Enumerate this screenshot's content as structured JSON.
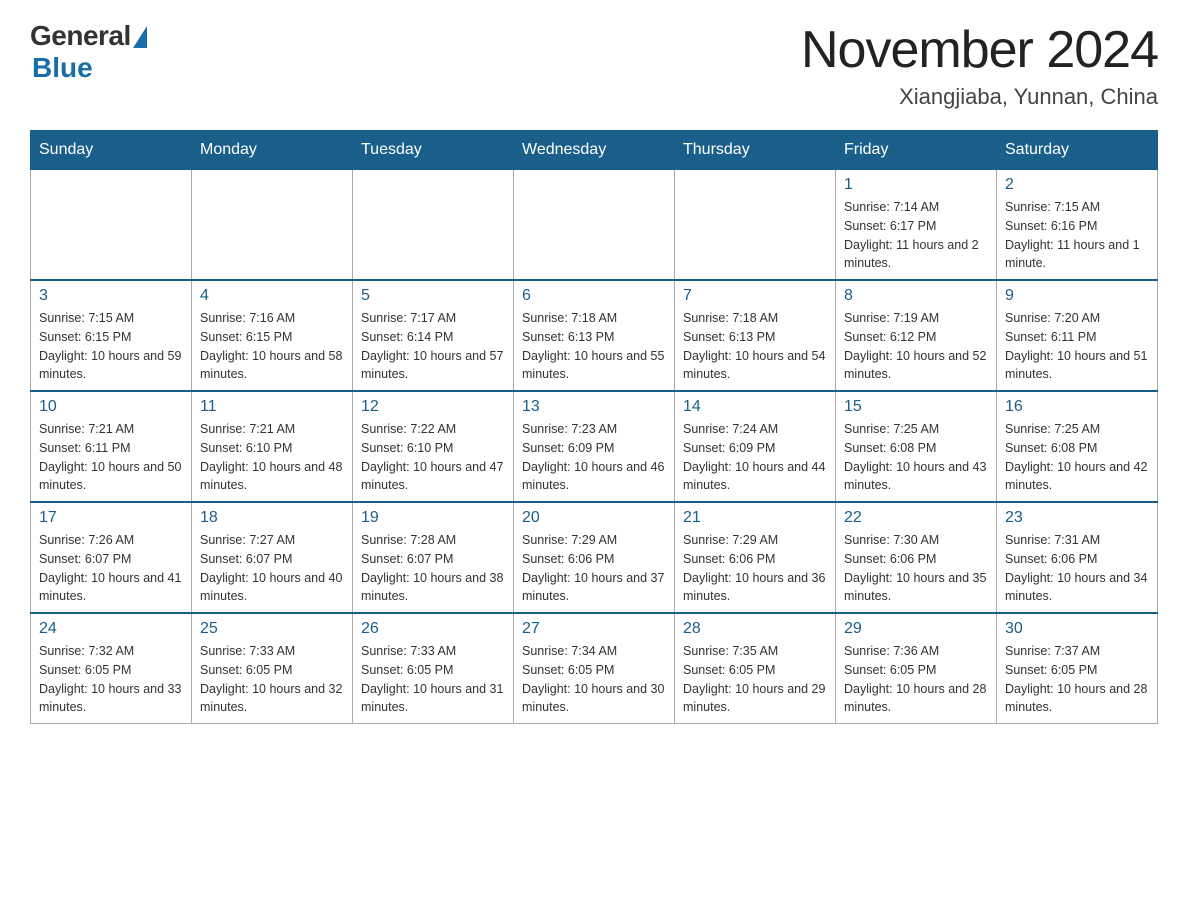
{
  "logo": {
    "general_text": "General",
    "blue_text": "Blue"
  },
  "title": "November 2024",
  "location": "Xiangjiaba, Yunnan, China",
  "days_of_week": [
    "Sunday",
    "Monday",
    "Tuesday",
    "Wednesday",
    "Thursday",
    "Friday",
    "Saturday"
  ],
  "weeks": [
    [
      {
        "day": "",
        "info": ""
      },
      {
        "day": "",
        "info": ""
      },
      {
        "day": "",
        "info": ""
      },
      {
        "day": "",
        "info": ""
      },
      {
        "day": "",
        "info": ""
      },
      {
        "day": "1",
        "info": "Sunrise: 7:14 AM\nSunset: 6:17 PM\nDaylight: 11 hours and 2 minutes."
      },
      {
        "day": "2",
        "info": "Sunrise: 7:15 AM\nSunset: 6:16 PM\nDaylight: 11 hours and 1 minute."
      }
    ],
    [
      {
        "day": "3",
        "info": "Sunrise: 7:15 AM\nSunset: 6:15 PM\nDaylight: 10 hours and 59 minutes."
      },
      {
        "day": "4",
        "info": "Sunrise: 7:16 AM\nSunset: 6:15 PM\nDaylight: 10 hours and 58 minutes."
      },
      {
        "day": "5",
        "info": "Sunrise: 7:17 AM\nSunset: 6:14 PM\nDaylight: 10 hours and 57 minutes."
      },
      {
        "day": "6",
        "info": "Sunrise: 7:18 AM\nSunset: 6:13 PM\nDaylight: 10 hours and 55 minutes."
      },
      {
        "day": "7",
        "info": "Sunrise: 7:18 AM\nSunset: 6:13 PM\nDaylight: 10 hours and 54 minutes."
      },
      {
        "day": "8",
        "info": "Sunrise: 7:19 AM\nSunset: 6:12 PM\nDaylight: 10 hours and 52 minutes."
      },
      {
        "day": "9",
        "info": "Sunrise: 7:20 AM\nSunset: 6:11 PM\nDaylight: 10 hours and 51 minutes."
      }
    ],
    [
      {
        "day": "10",
        "info": "Sunrise: 7:21 AM\nSunset: 6:11 PM\nDaylight: 10 hours and 50 minutes."
      },
      {
        "day": "11",
        "info": "Sunrise: 7:21 AM\nSunset: 6:10 PM\nDaylight: 10 hours and 48 minutes."
      },
      {
        "day": "12",
        "info": "Sunrise: 7:22 AM\nSunset: 6:10 PM\nDaylight: 10 hours and 47 minutes."
      },
      {
        "day": "13",
        "info": "Sunrise: 7:23 AM\nSunset: 6:09 PM\nDaylight: 10 hours and 46 minutes."
      },
      {
        "day": "14",
        "info": "Sunrise: 7:24 AM\nSunset: 6:09 PM\nDaylight: 10 hours and 44 minutes."
      },
      {
        "day": "15",
        "info": "Sunrise: 7:25 AM\nSunset: 6:08 PM\nDaylight: 10 hours and 43 minutes."
      },
      {
        "day": "16",
        "info": "Sunrise: 7:25 AM\nSunset: 6:08 PM\nDaylight: 10 hours and 42 minutes."
      }
    ],
    [
      {
        "day": "17",
        "info": "Sunrise: 7:26 AM\nSunset: 6:07 PM\nDaylight: 10 hours and 41 minutes."
      },
      {
        "day": "18",
        "info": "Sunrise: 7:27 AM\nSunset: 6:07 PM\nDaylight: 10 hours and 40 minutes."
      },
      {
        "day": "19",
        "info": "Sunrise: 7:28 AM\nSunset: 6:07 PM\nDaylight: 10 hours and 38 minutes."
      },
      {
        "day": "20",
        "info": "Sunrise: 7:29 AM\nSunset: 6:06 PM\nDaylight: 10 hours and 37 minutes."
      },
      {
        "day": "21",
        "info": "Sunrise: 7:29 AM\nSunset: 6:06 PM\nDaylight: 10 hours and 36 minutes."
      },
      {
        "day": "22",
        "info": "Sunrise: 7:30 AM\nSunset: 6:06 PM\nDaylight: 10 hours and 35 minutes."
      },
      {
        "day": "23",
        "info": "Sunrise: 7:31 AM\nSunset: 6:06 PM\nDaylight: 10 hours and 34 minutes."
      }
    ],
    [
      {
        "day": "24",
        "info": "Sunrise: 7:32 AM\nSunset: 6:05 PM\nDaylight: 10 hours and 33 minutes."
      },
      {
        "day": "25",
        "info": "Sunrise: 7:33 AM\nSunset: 6:05 PM\nDaylight: 10 hours and 32 minutes."
      },
      {
        "day": "26",
        "info": "Sunrise: 7:33 AM\nSunset: 6:05 PM\nDaylight: 10 hours and 31 minutes."
      },
      {
        "day": "27",
        "info": "Sunrise: 7:34 AM\nSunset: 6:05 PM\nDaylight: 10 hours and 30 minutes."
      },
      {
        "day": "28",
        "info": "Sunrise: 7:35 AM\nSunset: 6:05 PM\nDaylight: 10 hours and 29 minutes."
      },
      {
        "day": "29",
        "info": "Sunrise: 7:36 AM\nSunset: 6:05 PM\nDaylight: 10 hours and 28 minutes."
      },
      {
        "day": "30",
        "info": "Sunrise: 7:37 AM\nSunset: 6:05 PM\nDaylight: 10 hours and 28 minutes."
      }
    ]
  ]
}
